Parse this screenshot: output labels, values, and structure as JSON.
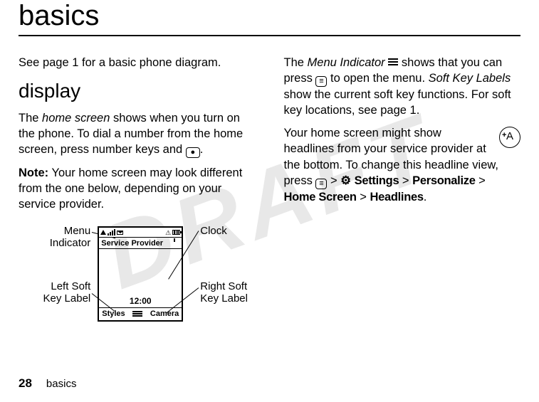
{
  "title": "basics",
  "watermark": "DRAFT",
  "leftColumn": {
    "intro": "See page 1 for a basic phone diagram.",
    "subhead": "display",
    "para1_a": "The ",
    "para1_home_screen": "home screen",
    "para1_b": " shows when you turn on the phone. To dial a number from the home screen, press number keys and ",
    "para1_c": ".",
    "note_label": "Note:",
    "note_text": " Your home screen may look different from the one below, depending on your service provider."
  },
  "rightColumn": {
    "p1_a": "The ",
    "p1_menu_indicator": "Menu Indicator",
    "p1_b": " shows that you can press ",
    "p1_c": " to open the menu. ",
    "p1_soft_key_labels": "Soft Key Labels",
    "p1_d": " show the current soft key functions. For soft key locations, see page 1.",
    "p2_a": "Your home screen might show headlines from your service provider at the bottom. To change this headline view, press ",
    "p2_gt1": " > ",
    "p2_settings": "Settings",
    "p2_gt2": " > ",
    "p2_personalize": "Personalize",
    "p2_gt3": " > ",
    "p2_homescreen": "Home Screen",
    "p2_gt4": " > ",
    "p2_headlines": "Headlines",
    "p2_end": "."
  },
  "diagram": {
    "labels": {
      "menu_indicator": "Menu\nIndicator",
      "left_soft": "Left Soft\nKey Label",
      "clock": "Clock",
      "right_soft": "Right Soft\nKey Label"
    },
    "phone": {
      "provider": "Service Provider",
      "clock": "12:00",
      "left_soft": "Styles",
      "right_soft": "Camera"
    }
  },
  "icons": {
    "call_key": "●",
    "menu_key": "≡",
    "tools_glyph": "⚙",
    "circle_letter": "A"
  },
  "footer": {
    "page": "28",
    "section": "basics"
  }
}
